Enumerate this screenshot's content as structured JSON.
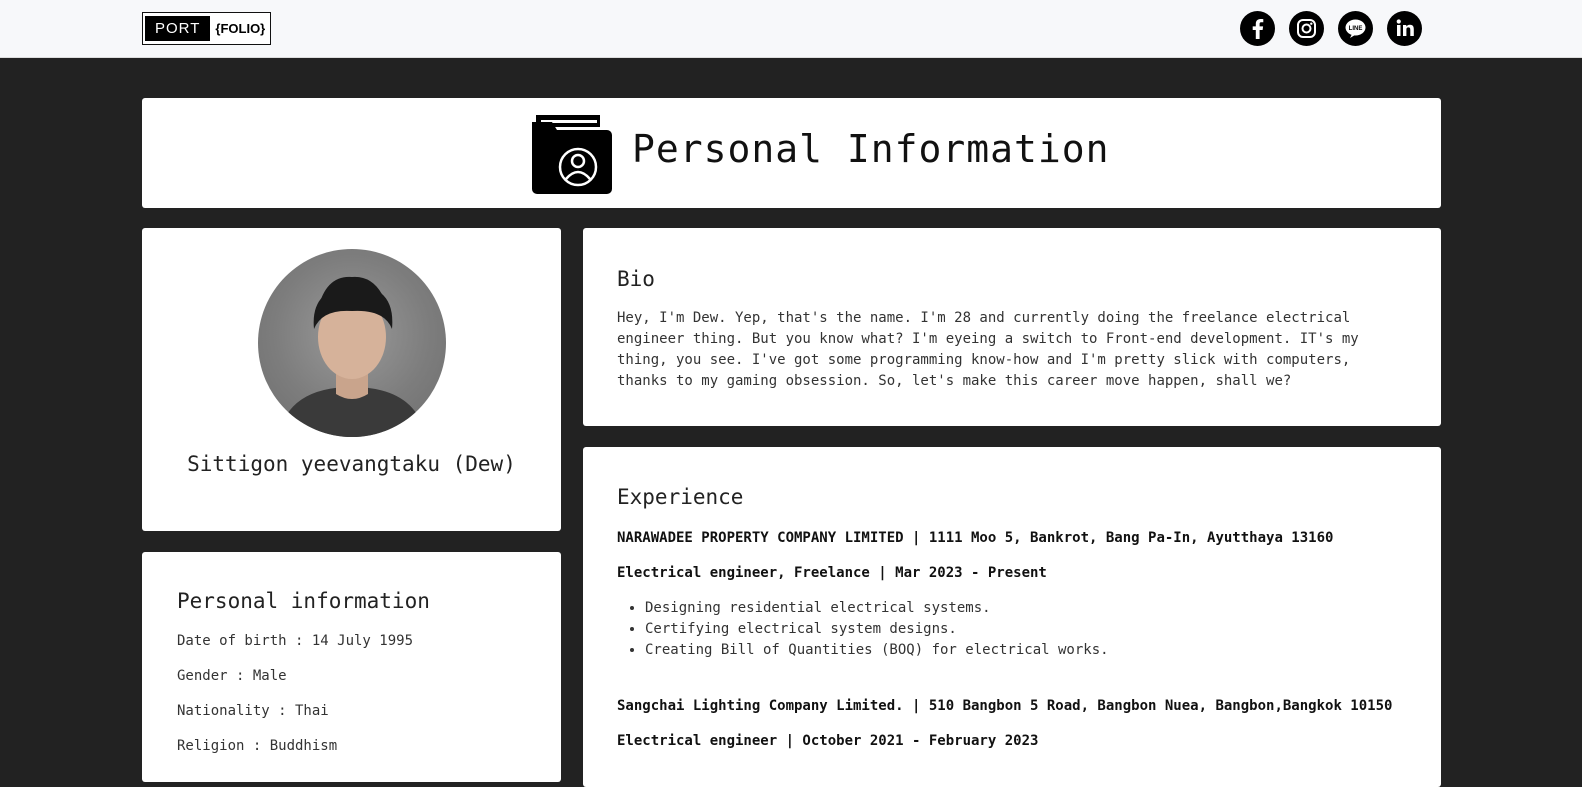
{
  "header": {
    "logo_left": "PORT",
    "logo_right": "{FOLIO}",
    "social": [
      "facebook-icon",
      "instagram-icon",
      "line-icon",
      "linkedin-icon"
    ]
  },
  "page_title": "Personal Information",
  "profile": {
    "name": "Sittigon yeevangtaku (Dew)"
  },
  "personal": {
    "heading": "Personal information",
    "dob": "Date of birth : 14 July 1995",
    "gender": "Gender : Male",
    "nationality": "Nationality : Thai",
    "religion": "Religion : Buddhism"
  },
  "bio": {
    "heading": "Bio",
    "text": "Hey, I'm Dew. Yep, that's the name. I'm 28 and currently doing the freelance electrical engineer thing. But you know what? I'm eyeing a switch to Front-end development. IT's my thing, you see. I've got some programming know-how and I'm pretty slick with computers, thanks to my gaming obsession. So, let's make this career move happen, shall we?"
  },
  "experience": {
    "heading": "Experience",
    "jobs": [
      {
        "company": "NARAWADEE PROPERTY COMPANY LIMITED | 1111 Moo 5, Bankrot, Bang Pa-In, Ayutthaya 13160",
        "role": "Electrical engineer, Freelance | Mar 2023 - Present",
        "duties": [
          "Designing residential electrical systems.",
          "Certifying electrical system designs.",
          "Creating Bill of Quantities (BOQ) for electrical works."
        ]
      },
      {
        "company": "Sangchai Lighting Company Limited. | 510 Bangbon 5 Road, Bangbon Nuea, Bangbon,Bangkok 10150",
        "role": "Electrical engineer | October 2021 - February 2023"
      }
    ]
  }
}
